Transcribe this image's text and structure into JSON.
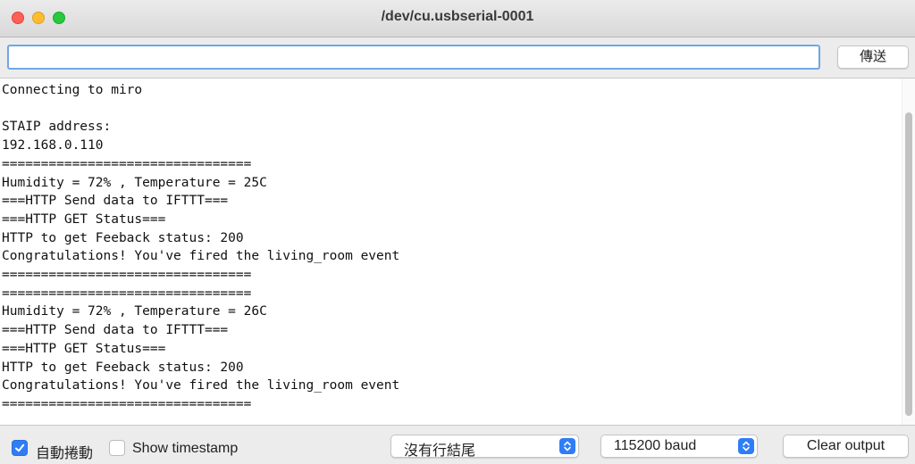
{
  "window": {
    "title": "/dev/cu.usbserial-0001"
  },
  "input": {
    "value": "",
    "send_label": "傳送"
  },
  "console": {
    "lines": [
      "Connecting to miro",
      "",
      "STAIP address:",
      "192.168.0.110",
      "================================",
      "Humidity = 72% , Temperature = 25C",
      "===HTTP Send data to IFTTT===",
      "===HTTP GET Status===",
      "HTTP to get Feeback status: 200",
      "Congratulations! You've fired the living_room event",
      "================================",
      "================================",
      "Humidity = 72% , Temperature = 26C",
      "===HTTP Send data to IFTTT===",
      "===HTTP GET Status===",
      "HTTP to get Feeback status: 200",
      "Congratulations! You've fired the living_room event",
      "================================"
    ]
  },
  "bottom": {
    "autoscroll_label": "自動捲動",
    "autoscroll_checked": true,
    "timestamp_label": "Show timestamp",
    "timestamp_checked": false,
    "line_ending_value": "沒有行結尾",
    "baud_value": "115200 baud",
    "clear_label": "Clear output"
  },
  "colors": {
    "accent": "#2f7df6",
    "close": "#fe5f57",
    "minimize": "#febc2e",
    "maximize": "#28c840"
  },
  "icons": {
    "checkmark": "checkmark-icon",
    "stepper": "updown-chevron-icon"
  }
}
